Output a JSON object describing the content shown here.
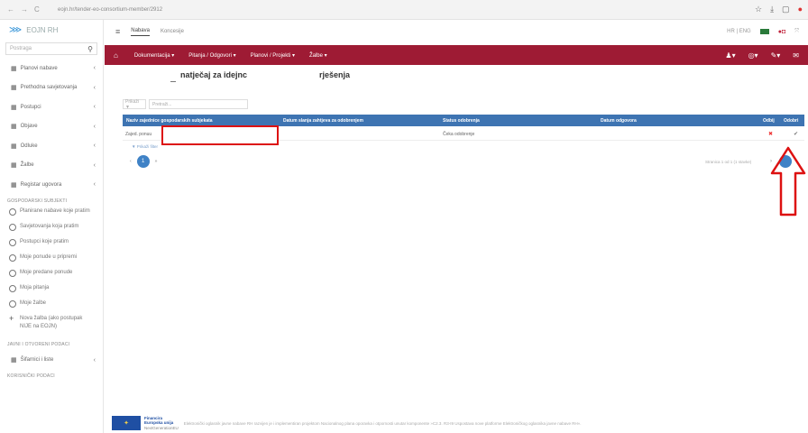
{
  "browser": {
    "url": "eojn.hr/tender-eo-consortium-member/2912",
    "nav_symbols": [
      "←",
      "→",
      "C"
    ],
    "right_icons": [
      "☆",
      "⤓",
      "▢",
      "●"
    ]
  },
  "sidebar": {
    "logo_text": "EOJN RH",
    "search_placeholder": "Postraga",
    "items": [
      {
        "label": "Planovi nabave"
      },
      {
        "label": "Prethodna savjetovanja"
      },
      {
        "label": "Postupci"
      },
      {
        "label": "Objave"
      },
      {
        "label": "Odluke"
      },
      {
        "label": "Žalbe"
      },
      {
        "label": "Registar ugovora"
      }
    ],
    "section_eo": "GOSPODARSKI SUBJEKTI",
    "eo_items": [
      {
        "label": "Planirane nabave koje pratim"
      },
      {
        "label": "Savjetovanja koja pratim"
      },
      {
        "label": "Postupci koje pratim"
      },
      {
        "label": "Moje ponude u pripremi"
      },
      {
        "label": "Moje predane ponude"
      },
      {
        "label": "Moja pitanja"
      },
      {
        "label": "Moje žalbe"
      }
    ],
    "new_complaint": "Nova žalba (ako postupak NIJE na EOJN)",
    "section_public": "JAVNI I OTVORENI PODACI",
    "public_item": "Šifarnici i liste",
    "section_user": "KORISNIČKI PODACI"
  },
  "topnav": {
    "tab_active": "Nabava",
    "tab_other": "Koncesije",
    "lang": "HR | ENG"
  },
  "redbar": {
    "menu": [
      "Dokumentacija ▾",
      "Pitanja / Odgovori ▾",
      "Planovi / Projekti ▾",
      "Žalbe ▾"
    ],
    "icons": [
      "♟▾",
      "◎▾",
      "✎▾",
      "✉"
    ]
  },
  "page": {
    "title_left": "natječaj za idejnc",
    "title_right": "rješenja"
  },
  "filter": {
    "select_value": "Prikaži ▼",
    "search_placeholder": "Pretraži..."
  },
  "table": {
    "headers": [
      "Naziv zajednice gospodarskih subjekata",
      "Datum slanja zahtjeva za odobrenjem",
      "Status odobrenja",
      "Datum odgovora",
      "Odbij",
      "Odobri"
    ],
    "row": {
      "name": "Zajed. ponuu",
      "status": "Čeka odobrenje",
      "reject": "✖",
      "approve": "✔"
    },
    "show_filter": "▼ Prikaži filter",
    "page_prev": "‹",
    "page_current": "1",
    "page_next": "»",
    "page_info": "Stranica 1 od 1 (1 stavke)",
    "page_info_next": "›"
  },
  "footer": {
    "eu_label_1": "Financira",
    "eu_label_2": "Europska unija",
    "eu_label_3": "NextGenerationEU",
    "text": "Elektronički oglasnik javne nabave RH razvijen je i implementiran projektom Nacionalnog plana oporavka i otpornosti unutar komponente »C2.3. R3-I9 Uspostava nove platforme Elektroničkog oglasnika javne nabave RH«."
  },
  "colors": {
    "accent_red": "#9e1b34",
    "table_header": "#3e74b2",
    "highlight_red": "#d11111"
  },
  "icons": {
    "hamburger": "≡",
    "home": "⌂",
    "grid": "▦",
    "chevron": "‹",
    "plus": "+"
  }
}
